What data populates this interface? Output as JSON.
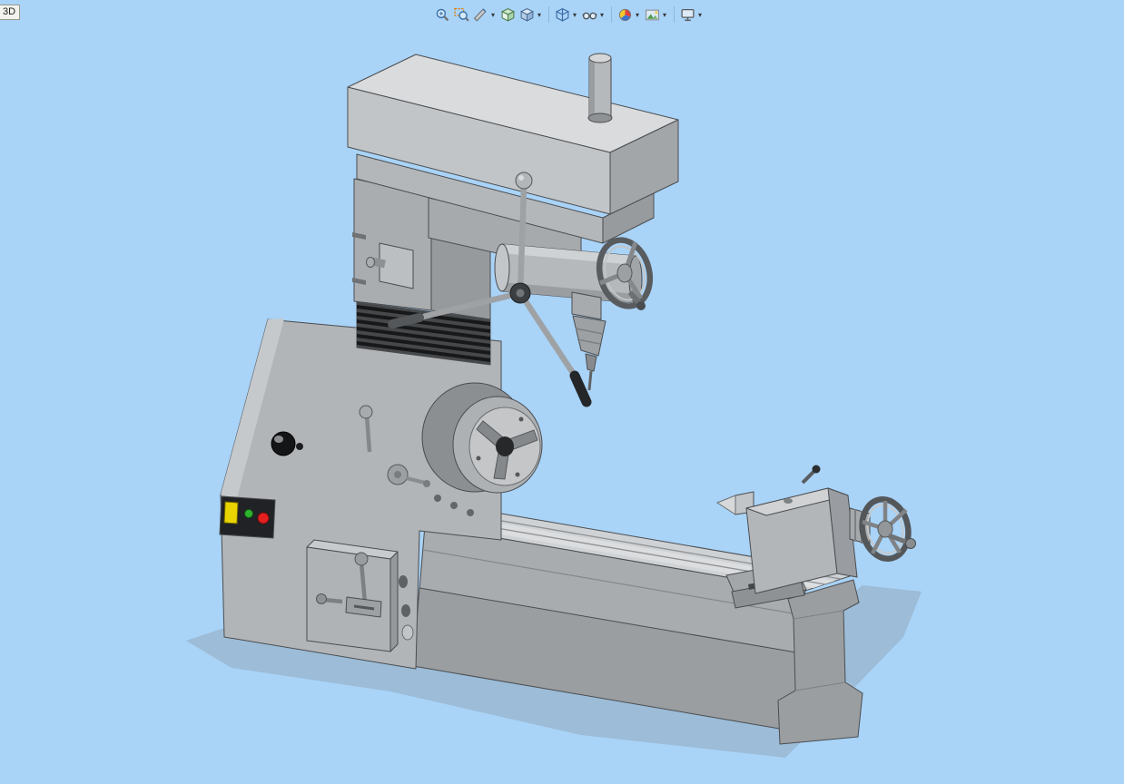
{
  "window": {
    "corner_label": "3D",
    "background_color": "#a9d3f7"
  },
  "ui": {
    "dropdown_arrow": "▾"
  },
  "toolbar": {
    "name": "heads-up-view-toolbar",
    "items": [
      {
        "icon": "zoom-to-fit-icon",
        "action": "zoom-to-fit",
        "dropdown": false
      },
      {
        "icon": "zoom-to-area-icon",
        "action": "zoom-to-area",
        "dropdown": false
      },
      {
        "icon": "section-view-icon",
        "action": "section-view",
        "dropdown": true
      },
      {
        "icon": "annotation-views-icon",
        "action": "annotation-views",
        "dropdown": false
      },
      {
        "icon": "view-orientation-icon",
        "action": "view-orientation",
        "dropdown": true
      },
      {
        "icon": "display-style-icon",
        "action": "display-style",
        "dropdown": true
      },
      {
        "icon": "hide-show-items-icon",
        "action": "hide-show-items",
        "dropdown": true
      },
      {
        "icon": "edit-appearance-icon",
        "action": "edit-appearance",
        "dropdown": true
      },
      {
        "icon": "apply-scene-icon",
        "action": "apply-scene",
        "dropdown": true
      },
      {
        "icon": "view-settings-icon",
        "action": "view-settings",
        "dropdown": true
      }
    ]
  },
  "model": {
    "description": "Gray 3-in-1 combination lathe with mill-drill head, shaded-with-edges isometric view on blue viewport background",
    "parts": [
      "mill-head",
      "drawbar",
      "spindle-housing",
      "quill-handwheel",
      "drill-chuck",
      "feed-star-handle",
      "mill-column",
      "column-bellows",
      "headstock",
      "three-jaw-chuck",
      "power-knob",
      "control-buttons",
      "apron-gearbox",
      "lathe-bed",
      "bed-foot",
      "tailstock",
      "dead-center",
      "tailstock-handwheel",
      "machine-shadow"
    ],
    "colors": {
      "body_light": "#d9dbdd",
      "body_mid": "#b2b5b8",
      "body_dark": "#9a9da0",
      "edge_outline": "#4a4d50",
      "bellows_black": "#17181a",
      "button_yellow": "#e8d400",
      "button_green": "#2db32d",
      "button_red": "#e31f1f",
      "shadow": "#8fa5b8"
    }
  }
}
